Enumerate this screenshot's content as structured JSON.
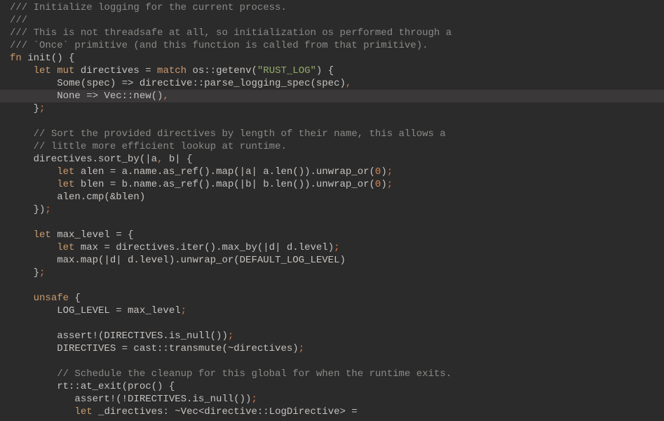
{
  "colors": {
    "bg": "#2c2b2b",
    "fg": "#c5c3c0",
    "comment": "#8a8a87",
    "keyword": "#c99b6f",
    "string": "#92ac67",
    "number": "#d28a56",
    "highlight_bg": "#3a3838",
    "orange_punct": "#cc7b4e"
  },
  "highlighted_line_index": 7,
  "lines": [
    {
      "tokens": [
        [
          "comment",
          "/// Initialize logging for the current process."
        ]
      ]
    },
    {
      "tokens": [
        [
          "comment",
          "///"
        ]
      ]
    },
    {
      "tokens": [
        [
          "comment",
          "/// This is not threadsafe at all, so initialization os performed through a"
        ]
      ]
    },
    {
      "tokens": [
        [
          "comment",
          "/// `Once` primitive (and this function is called from that primitive)."
        ]
      ]
    },
    {
      "tokens": [
        [
          "keyword",
          "fn"
        ],
        [
          "def",
          " init"
        ],
        [
          "punct",
          "() {"
        ]
      ]
    },
    {
      "tokens": [
        [
          "ident",
          "    "
        ],
        [
          "keyword",
          "let mut"
        ],
        [
          "ident",
          " directives = "
        ],
        [
          "keyword",
          "match"
        ],
        [
          "ident",
          " os::getenv("
        ],
        [
          "string",
          "\"RUST_LOG\""
        ],
        [
          "punct",
          ") {"
        ]
      ]
    },
    {
      "tokens": [
        [
          "ident",
          "        Some(spec) => directive::parse_logging_spec(spec)"
        ],
        [
          "orange_punct",
          ","
        ]
      ]
    },
    {
      "tokens": [
        [
          "ident",
          "        None => Vec::new()"
        ],
        [
          "orange_punct",
          ","
        ]
      ]
    },
    {
      "tokens": [
        [
          "ident",
          "    }"
        ],
        [
          "orange_punct",
          ";"
        ]
      ]
    },
    {
      "tokens": []
    },
    {
      "tokens": [
        [
          "ident",
          "    "
        ],
        [
          "comment",
          "// Sort the provided directives by length of their name, this allows a"
        ]
      ]
    },
    {
      "tokens": [
        [
          "ident",
          "    "
        ],
        [
          "comment",
          "// little more efficient lookup at runtime."
        ]
      ]
    },
    {
      "tokens": [
        [
          "ident",
          "    directives.sort_by(|a"
        ],
        [
          "orange_punct",
          ","
        ],
        [
          "ident",
          " b| {"
        ]
      ]
    },
    {
      "tokens": [
        [
          "ident",
          "        "
        ],
        [
          "keyword",
          "let"
        ],
        [
          "ident",
          " alen = a.name.as_ref().map(|a| a.len()).unwrap_or("
        ],
        [
          "number",
          "0"
        ],
        [
          "ident",
          ")"
        ],
        [
          "orange_punct",
          ";"
        ]
      ]
    },
    {
      "tokens": [
        [
          "ident",
          "        "
        ],
        [
          "keyword",
          "let"
        ],
        [
          "ident",
          " blen = b.name.as_ref().map(|b| b.len()).unwrap_or("
        ],
        [
          "number",
          "0"
        ],
        [
          "ident",
          ")"
        ],
        [
          "orange_punct",
          ";"
        ]
      ]
    },
    {
      "tokens": [
        [
          "ident",
          "        alen.cmp(&blen)"
        ]
      ]
    },
    {
      "tokens": [
        [
          "ident",
          "    })"
        ],
        [
          "orange_punct",
          ";"
        ]
      ]
    },
    {
      "tokens": []
    },
    {
      "tokens": [
        [
          "ident",
          "    "
        ],
        [
          "keyword",
          "let"
        ],
        [
          "ident",
          " max_level = {"
        ]
      ]
    },
    {
      "tokens": [
        [
          "ident",
          "        "
        ],
        [
          "keyword",
          "let"
        ],
        [
          "ident",
          " max = directives.iter().max_by(|d| d.level)"
        ],
        [
          "orange_punct",
          ";"
        ]
      ]
    },
    {
      "tokens": [
        [
          "ident",
          "        max.map(|d| d.level).unwrap_or(DEFAULT_LOG_LEVEL)"
        ]
      ]
    },
    {
      "tokens": [
        [
          "ident",
          "    }"
        ],
        [
          "orange_punct",
          ";"
        ]
      ]
    },
    {
      "tokens": []
    },
    {
      "tokens": [
        [
          "ident",
          "    "
        ],
        [
          "keyword",
          "unsafe"
        ],
        [
          "ident",
          " {"
        ]
      ]
    },
    {
      "tokens": [
        [
          "ident",
          "        LOG_LEVEL = max_level"
        ],
        [
          "orange_punct",
          ";"
        ]
      ]
    },
    {
      "tokens": []
    },
    {
      "tokens": [
        [
          "ident",
          "        assert!(DIRECTIVES.is_null())"
        ],
        [
          "orange_punct",
          ";"
        ]
      ]
    },
    {
      "tokens": [
        [
          "ident",
          "        DIRECTIVES = cast::transmute(~directives)"
        ],
        [
          "orange_punct",
          ";"
        ]
      ]
    },
    {
      "tokens": []
    },
    {
      "tokens": [
        [
          "ident",
          "        "
        ],
        [
          "comment",
          "// Schedule the cleanup for this global for when the runtime exits."
        ]
      ]
    },
    {
      "tokens": [
        [
          "ident",
          "        rt::at_exit(proc() {"
        ]
      ]
    },
    {
      "tokens": [
        [
          "ident",
          "           assert!(!DIRECTIVES.is_null())"
        ],
        [
          "orange_punct",
          ";"
        ]
      ]
    },
    {
      "tokens": [
        [
          "ident",
          "           "
        ],
        [
          "keyword",
          "let"
        ],
        [
          "ident",
          " _directives: ~Vec<directive::LogDirective> ="
        ]
      ]
    }
  ]
}
